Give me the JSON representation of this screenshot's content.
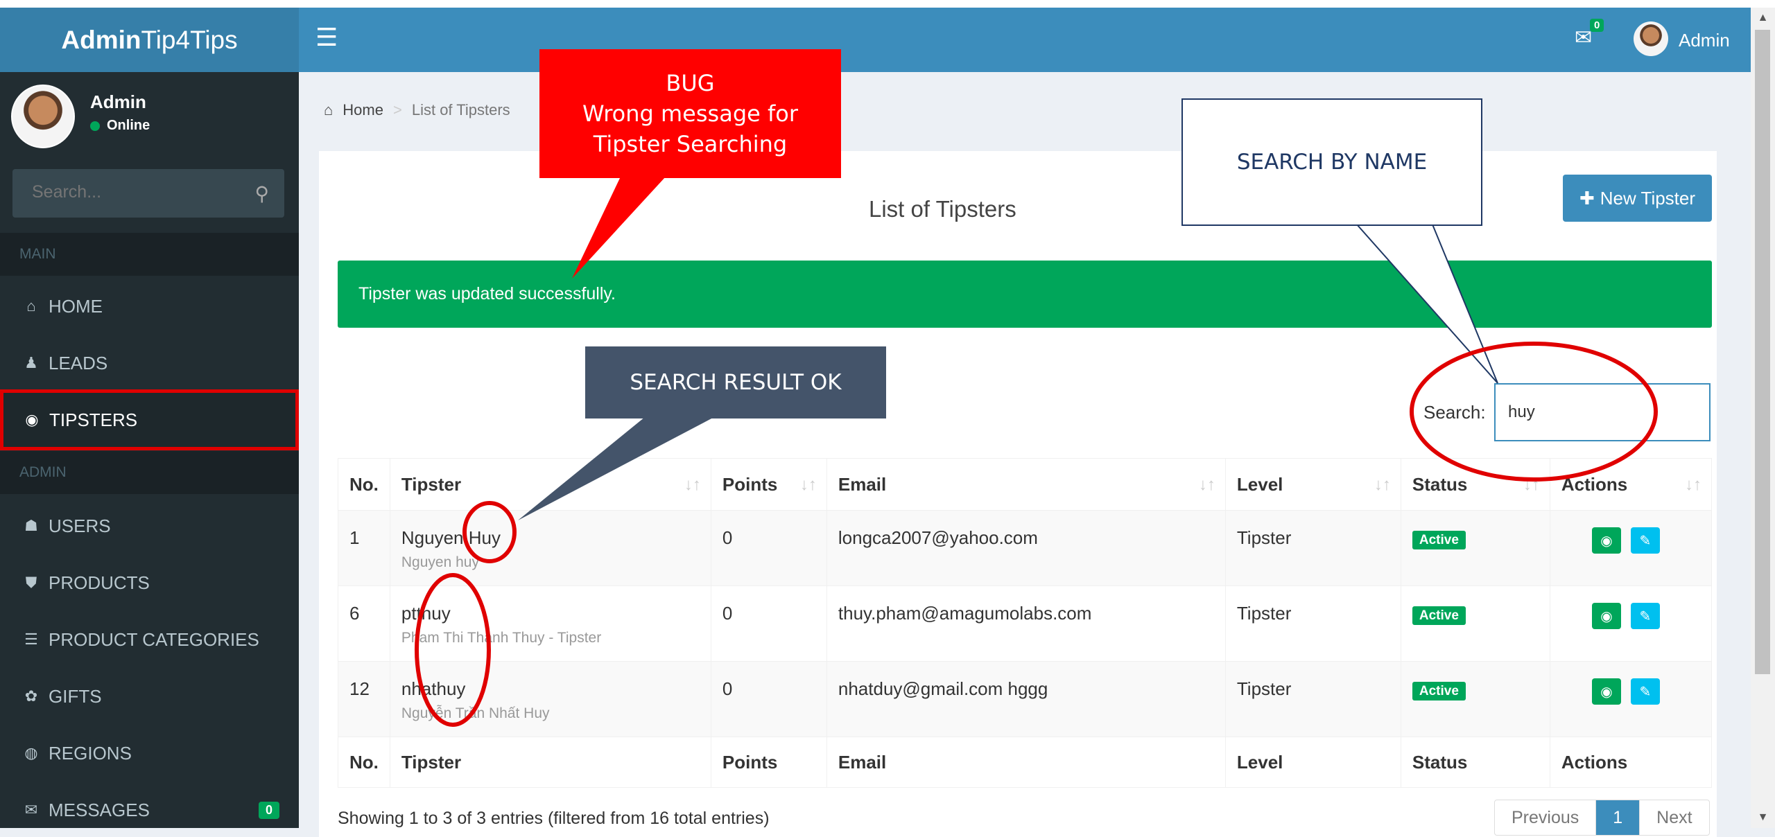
{
  "app": {
    "logo_bold": "Admin",
    "logo_rest": "Tip4Tips"
  },
  "sidebar": {
    "user_name": "Admin",
    "user_status": "Online",
    "search_placeholder": "Search...",
    "sections": {
      "main": "MAIN",
      "admin": "ADMIN"
    },
    "items": [
      {
        "label": "HOME",
        "icon": "home-icon",
        "glyph": "🏠"
      },
      {
        "label": "LEADS",
        "icon": "person-icon",
        "glyph": "♟"
      },
      {
        "label": "TIPSTERS",
        "icon": "eye-icon",
        "glyph": "👁"
      },
      {
        "label": "USERS",
        "icon": "users-icon",
        "glyph": "👥"
      },
      {
        "label": "PRODUCTS",
        "icon": "shield-icon",
        "glyph": "⛊"
      },
      {
        "label": "PRODUCT CATEGORIES",
        "icon": "list-icon",
        "glyph": "☰"
      },
      {
        "label": "GIFTS",
        "icon": "gift-icon",
        "glyph": "🎁"
      },
      {
        "label": "REGIONS",
        "icon": "globe-icon",
        "glyph": "◉"
      },
      {
        "label": "MESSAGES",
        "icon": "envelope-icon",
        "glyph": "✉",
        "badge": "0"
      }
    ]
  },
  "navbar": {
    "mail_badge": "0",
    "user_label": "Admin"
  },
  "breadcrumb": {
    "home": "Home",
    "current": "List of Tipsters"
  },
  "main": {
    "title": "List of Tipsters",
    "new_button": "New Tipster",
    "alert": "Tipster was updated successfully.",
    "search_label": "Search:",
    "search_value": "huy",
    "columns": [
      "No.",
      "Tipster",
      "Points",
      "Email",
      "Level",
      "Status",
      "Actions"
    ],
    "rows": [
      {
        "no": "1",
        "tipster": "Nguyen Huy",
        "sub": "Nguyen huy",
        "points": "0",
        "email": "longca2007@yahoo.com",
        "level": "Tipster",
        "status": "Active"
      },
      {
        "no": "6",
        "tipster": "ptthuy",
        "sub": "Pham Thi Thanh Thuy - Tipster",
        "points": "0",
        "email": "thuy.pham@amagumolabs.com",
        "level": "Tipster",
        "status": "Active"
      },
      {
        "no": "12",
        "tipster": "nhathuy",
        "sub": "Nguyễn Trần Nhất Huy",
        "points": "0",
        "email": "nhatduy@gmail.com hggg",
        "level": "Tipster",
        "status": "Active"
      }
    ],
    "info": "Showing 1 to 3 of 3 entries (filtered from 16 total entries)",
    "pager": {
      "prev": "Previous",
      "current": "1",
      "next": "Next"
    }
  },
  "annotations": {
    "bug_line1": "BUG",
    "bug_line2": "Wrong message for",
    "bug_line3": "Tipster Searching",
    "search_by_name": "SEARCH BY NAME",
    "search_result": "SEARCH RESULT OK"
  },
  "colors": {
    "navbar": "#3c8dbc",
    "logo_bg": "#367fa9",
    "sidebar": "#222d32",
    "success": "#00a65a",
    "info": "#00c0ef",
    "annotation_red": "#ff0000",
    "annotation_slate": "#44546a"
  }
}
